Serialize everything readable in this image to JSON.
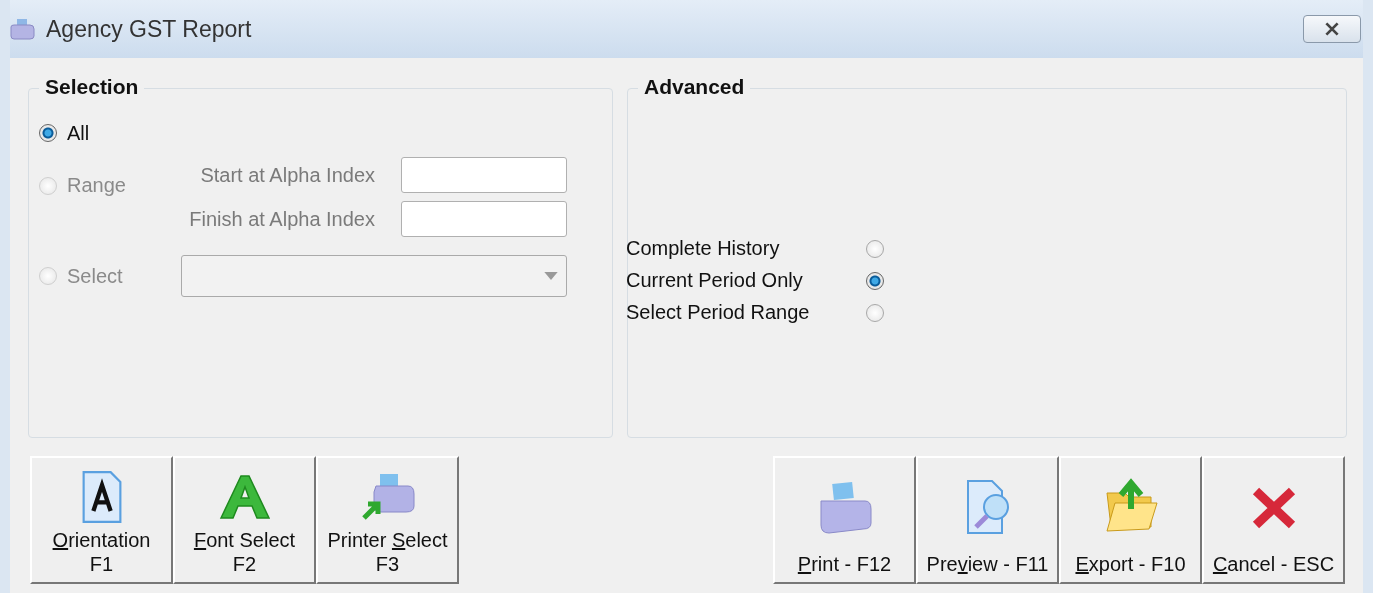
{
  "window": {
    "title": "Agency GST Report"
  },
  "selection": {
    "title": "Selection",
    "options": [
      {
        "label": "All",
        "selected": true,
        "disabled": false
      },
      {
        "label": "Range",
        "selected": false,
        "disabled": true
      },
      {
        "label": "Select",
        "selected": false,
        "disabled": true
      }
    ],
    "range_fields": [
      {
        "label": "Start at Alpha Index"
      },
      {
        "label": "Finish at Alpha Index"
      }
    ],
    "select_dropdown": {
      "disabled": true
    }
  },
  "advanced": {
    "title": "Advanced",
    "options": [
      {
        "label": "Complete History",
        "selected": false
      },
      {
        "label": "Current Period Only",
        "selected": true
      },
      {
        "label": "Select Period Range",
        "selected": false
      }
    ]
  },
  "left_buttons": [
    {
      "kind": "orientation",
      "key": "O",
      "post": "rientation",
      "sub": "F1"
    },
    {
      "kind": "font",
      "key": "F",
      "post": "ont Select",
      "sub": "F2"
    },
    {
      "kind": "printer",
      "pre": "Printer ",
      "key": "S",
      "post": "elect",
      "sub": "F3"
    }
  ],
  "right_buttons": [
    {
      "kind": "print",
      "key": "P",
      "post": "rint - F12"
    },
    {
      "kind": "preview",
      "pre": "Pre",
      "key": "v",
      "post": "iew - F11"
    },
    {
      "kind": "export",
      "key": "E",
      "post": "xport - F10"
    },
    {
      "kind": "cancel",
      "key": "C",
      "post": "ancel - ESC"
    }
  ]
}
